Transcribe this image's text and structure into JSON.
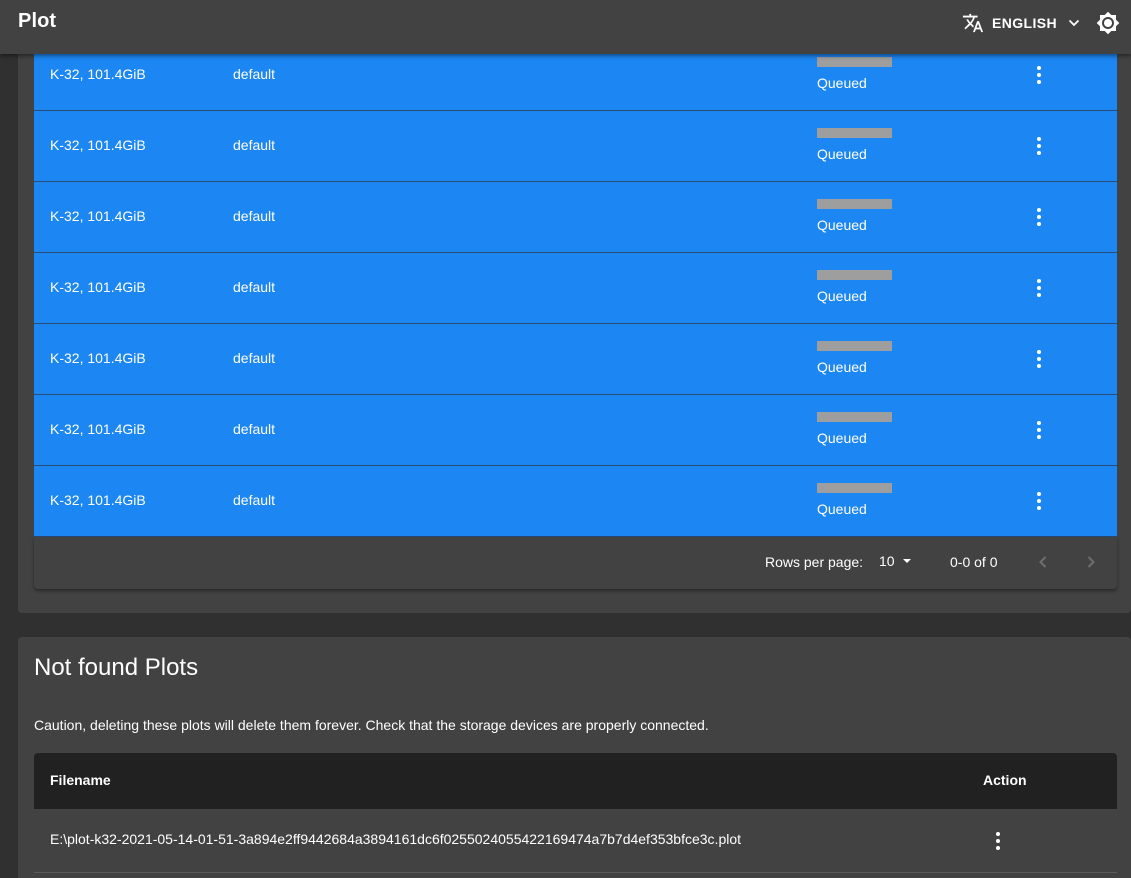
{
  "app": {
    "title": "Plot",
    "language_label": "ENGLISH",
    "translate_icon": "translate-icon",
    "chevron_icon": "chevron-down-icon",
    "theme_icon": "brightness-icon"
  },
  "plots": {
    "rows": [
      {
        "size": "K-32, 101.4GiB",
        "queue": "default",
        "state": "Queued",
        "progress": 0
      },
      {
        "size": "K-32, 101.4GiB",
        "queue": "default",
        "state": "Queued",
        "progress": 0
      },
      {
        "size": "K-32, 101.4GiB",
        "queue": "default",
        "state": "Queued",
        "progress": 0
      },
      {
        "size": "K-32, 101.4GiB",
        "queue": "default",
        "state": "Queued",
        "progress": 0
      },
      {
        "size": "K-32, 101.4GiB",
        "queue": "default",
        "state": "Queued",
        "progress": 0
      },
      {
        "size": "K-32, 101.4GiB",
        "queue": "default",
        "state": "Queued",
        "progress": 0
      },
      {
        "size": "K-32, 101.4GiB",
        "queue": "default",
        "state": "Queued",
        "progress": 0
      }
    ],
    "pagination": {
      "rows_per_page_label": "Rows per page:",
      "rows_per_page": "10",
      "range": "0-0 of 0"
    }
  },
  "not_found": {
    "title": "Not found Plots",
    "caution": "Caution, deleting these plots will delete them forever. Check that the storage devices are properly connected.",
    "headers": {
      "filename": "Filename",
      "action": "Action"
    },
    "rows": [
      {
        "filename": "E:\\plot-k32-2021-05-14-01-51-3a894e2ff9442684a3894161dc6f0255024055422169474a7b7d4ef353bfce3c.plot"
      }
    ]
  },
  "colors": {
    "row_accent": "#1c86f2",
    "surface": "#424242",
    "background": "#303030",
    "header_dark": "#212121"
  }
}
